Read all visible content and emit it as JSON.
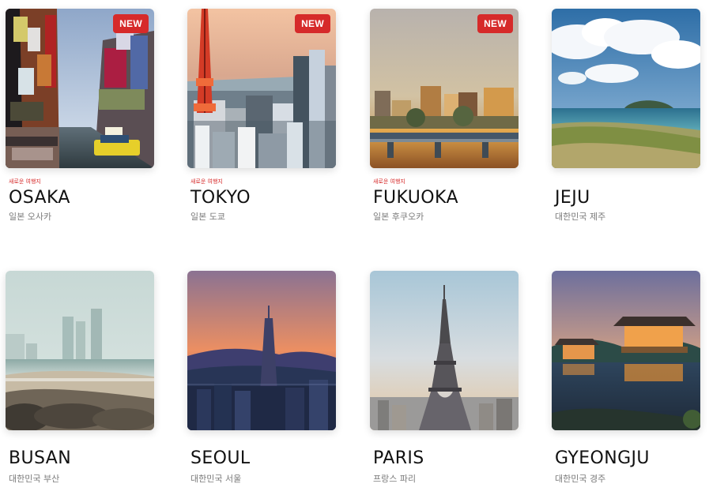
{
  "colors": {
    "badge": "#d62a2a",
    "tag_text": "#d62a2a",
    "name_text": "#111111",
    "country_text": "#7a7a7a"
  },
  "destinations": [
    {
      "name": "OSAKA",
      "country_label": "일본 오사카",
      "tag": "새로운 여행지",
      "badge": "NEW",
      "image_icon": "city-canal-icon"
    },
    {
      "name": "TOKYO",
      "country_label": "일본 도쿄",
      "tag": "새로운 여행지",
      "badge": "NEW",
      "image_icon": "tokyo-tower-icon"
    },
    {
      "name": "FUKUOKA",
      "country_label": "일본 후쿠오카",
      "tag": "새로운 여행지",
      "badge": "NEW",
      "image_icon": "bridge-sunset-icon"
    },
    {
      "name": "JEJU",
      "country_label": "대한민국 제주",
      "image_icon": "island-coast-icon"
    },
    {
      "name": "BUSAN",
      "country_label": "대한민국 부산",
      "image_icon": "beach-skyline-icon"
    },
    {
      "name": "SEOUL",
      "country_label": "대한민국 서울",
      "image_icon": "city-night-tower-icon"
    },
    {
      "name": "PARIS",
      "country_label": "프랑스 파리",
      "image_icon": "eiffel-tower-icon"
    },
    {
      "name": "GYEONGJU",
      "country_label": "대한민국 경주",
      "image_icon": "pavilion-lake-icon"
    }
  ]
}
